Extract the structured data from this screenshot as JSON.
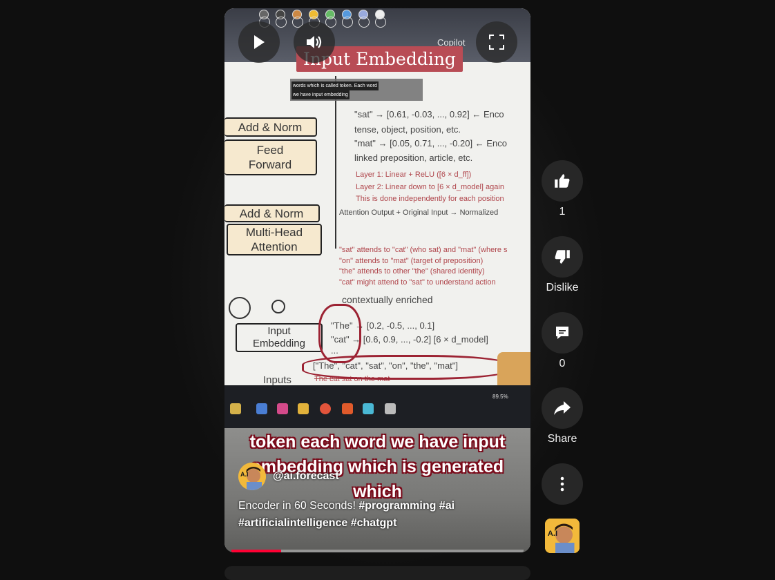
{
  "player": {
    "slide_title": "Input Embedding",
    "caption_line1": "words which is called token. Each word",
    "caption_line2": "we have input embedding",
    "copilot_label": "Copilot",
    "board": {
      "add_norm_top": "Add & Norm",
      "feed_forward_1": "Feed",
      "feed_forward_2": "Forward",
      "add_norm_mid": "Add & Norm",
      "mha_1": "Multi-Head",
      "mha_2": "Attention",
      "input_emb_1": "Input",
      "input_emb_2": "Embedding",
      "inputs_label": "Inputs",
      "note_sat": "\"sat\" → [0.61, -0.03, ..., 0.92]  ← Enco",
      "note_tense": "tense, object, position, etc.",
      "note_mat": "\"mat\" → [0.05, 0.71, ..., -0.20]  ← Enco",
      "note_linked": "linked preposition, article, etc.",
      "layer1": "Layer 1: Linear + ReLU ([6 × d_ff])",
      "layer2": "Layer 2: Linear down to [6 × d_model] again",
      "layer_note": "This is done independently for each position",
      "attn_output": "Attention Output + Original Input → Normalized",
      "attends1": "\"sat\" attends to \"cat\" (who sat) and \"mat\" (where s",
      "attends2": "\"on\" attends to \"mat\" (target of preposition)",
      "attends3": "\"the\" attends to other \"the\" (shared identity)",
      "attends4": "\"cat\" might attend to \"sat\" to understand action",
      "contextual": "contextually enriched",
      "the_vec": "\"The\" → [0.2, -0.5, ..., 0.1]",
      "cat_vec": "\"cat\" → [0.6, 0.9, ..., -0.2]   [6 × d_model]",
      "ellipsis": "...",
      "tokens": "[\"The\", \"cat\", \"sat\", \"on\", \"the\", \"mat\"]",
      "sentence": "The cat sat on the mat"
    },
    "taskbar_zoom": "89.5%",
    "subtitle_line1": "token each word we have input",
    "subtitle_line2": "embedding which is generated",
    "subtitle_line3": "which",
    "channel_name": "@ai.forecast",
    "title_plain": "Encoder in 60 Seconds! ",
    "title_tags_1": "#programming #ai",
    "title_tags_2": "#artificialintelligence #chatgpt",
    "progress_fraction": 0.17
  },
  "actions": {
    "like_count": "1",
    "dislike_label": "Dislike",
    "comment_count": "0",
    "share_label": "Share"
  },
  "colors": {
    "background": "#0f0f0f",
    "progress": "#ff0033",
    "action_button": "#272727",
    "title_badge": "#b84c55"
  }
}
